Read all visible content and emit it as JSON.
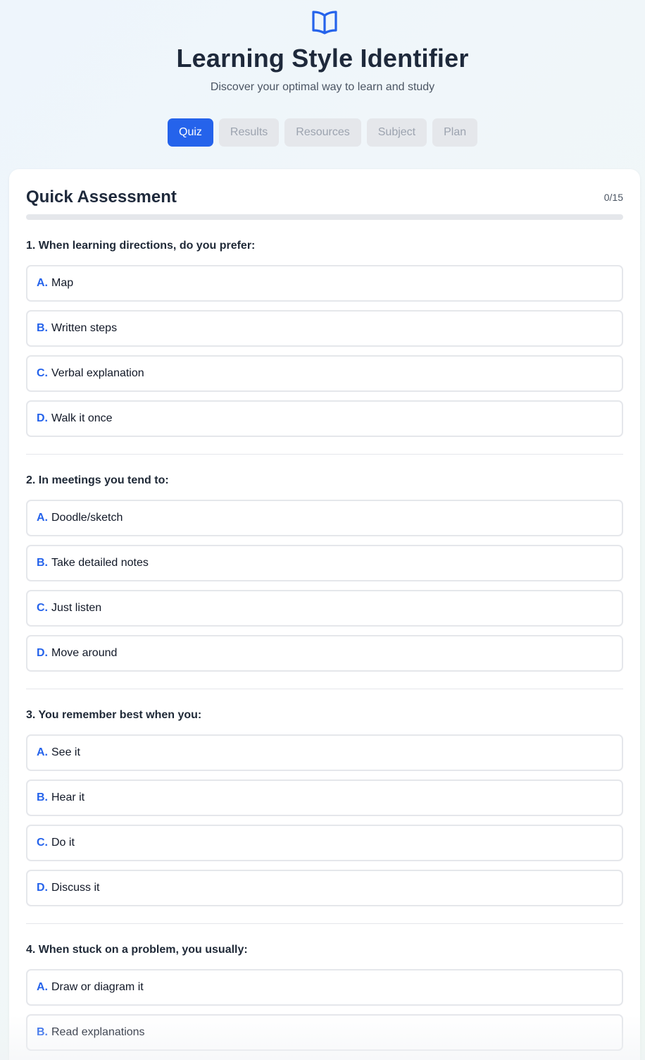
{
  "header": {
    "icon": "open-book-icon",
    "title": "Learning Style Identifier",
    "subtitle": "Discover your optimal way to learn and study",
    "accent_color": "#2563eb"
  },
  "tabs": [
    {
      "label": "Quiz",
      "active": true
    },
    {
      "label": "Results",
      "active": false
    },
    {
      "label": "Resources",
      "active": false
    },
    {
      "label": "Subject",
      "active": false
    },
    {
      "label": "Plan",
      "active": false
    }
  ],
  "quiz": {
    "title": "Quick Assessment",
    "progress_text": "0/15",
    "progress_fraction": 0,
    "questions": [
      {
        "text": "1. When learning directions, do you prefer:",
        "options": [
          {
            "letter": "A.",
            "text": "Map"
          },
          {
            "letter": "B.",
            "text": "Written steps"
          },
          {
            "letter": "C.",
            "text": "Verbal explanation"
          },
          {
            "letter": "D.",
            "text": "Walk it once"
          }
        ]
      },
      {
        "text": "2. In meetings you tend to:",
        "options": [
          {
            "letter": "A.",
            "text": "Doodle/sketch"
          },
          {
            "letter": "B.",
            "text": "Take detailed notes"
          },
          {
            "letter": "C.",
            "text": "Just listen"
          },
          {
            "letter": "D.",
            "text": "Move around"
          }
        ]
      },
      {
        "text": "3. You remember best when you:",
        "options": [
          {
            "letter": "A.",
            "text": "See it"
          },
          {
            "letter": "B.",
            "text": "Hear it"
          },
          {
            "letter": "C.",
            "text": "Do it"
          },
          {
            "letter": "D.",
            "text": "Discuss it"
          }
        ]
      },
      {
        "text": "4. When stuck on a problem, you usually:",
        "options": [
          {
            "letter": "A.",
            "text": "Draw or diagram it"
          },
          {
            "letter": "B.",
            "text": "Read explanations"
          }
        ]
      }
    ]
  }
}
